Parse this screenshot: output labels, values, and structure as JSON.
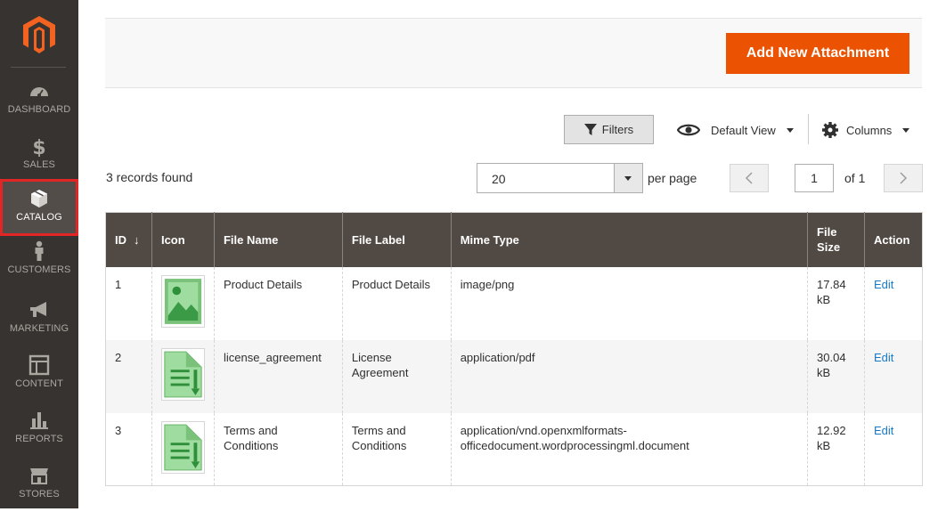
{
  "sidebar": {
    "items": [
      {
        "label": "DASHBOARD",
        "icon": "dashboard-icon"
      },
      {
        "label": "SALES",
        "icon": "dollar-icon"
      },
      {
        "label": "CATALOG",
        "icon": "box-icon"
      },
      {
        "label": "CUSTOMERS",
        "icon": "person-icon"
      },
      {
        "label": "MARKETING",
        "icon": "megaphone-icon"
      },
      {
        "label": "CONTENT",
        "icon": "layout-icon"
      },
      {
        "label": "REPORTS",
        "icon": "bar-chart-icon"
      },
      {
        "label": "STORES",
        "icon": "store-icon"
      }
    ],
    "active": "CATALOG"
  },
  "toolbar": {
    "add_label": "Add New Attachment",
    "filters_label": "Filters",
    "view_label": "Default View",
    "columns_label": "Columns"
  },
  "grid": {
    "records_found": "3 records found",
    "page_size": "20",
    "per_page_label": "per page",
    "current_page": "1",
    "of_pages": "of 1",
    "columns": [
      "ID",
      "Icon",
      "File Name",
      "File Label",
      "Mime Type",
      "File Size",
      "Action"
    ],
    "sort_arrow": "↓",
    "rows": [
      {
        "id": "1",
        "icon": "image-file-icon",
        "file_name": "Product Details",
        "file_label": "Product Details",
        "mime": "image/png",
        "size": "17.84 kB",
        "action": "Edit"
      },
      {
        "id": "2",
        "icon": "document-file-icon",
        "file_name": "license_agreement",
        "file_label": "License Agreement",
        "mime": "application/pdf",
        "size": "30.04 kB",
        "action": "Edit"
      },
      {
        "id": "3",
        "icon": "document-file-icon",
        "file_name": "Terms and Conditions",
        "file_label": "Terms and Conditions",
        "mime": "application/vnd.openxmlformats-officedocument.wordprocessingml.document",
        "size": "12.92 kB",
        "action": "Edit"
      }
    ]
  },
  "colors": {
    "accent": "#eb5202",
    "sidebar_bg": "#373330",
    "header_bg": "#514943",
    "link": "#1979c3",
    "highlight": "#e22626"
  }
}
